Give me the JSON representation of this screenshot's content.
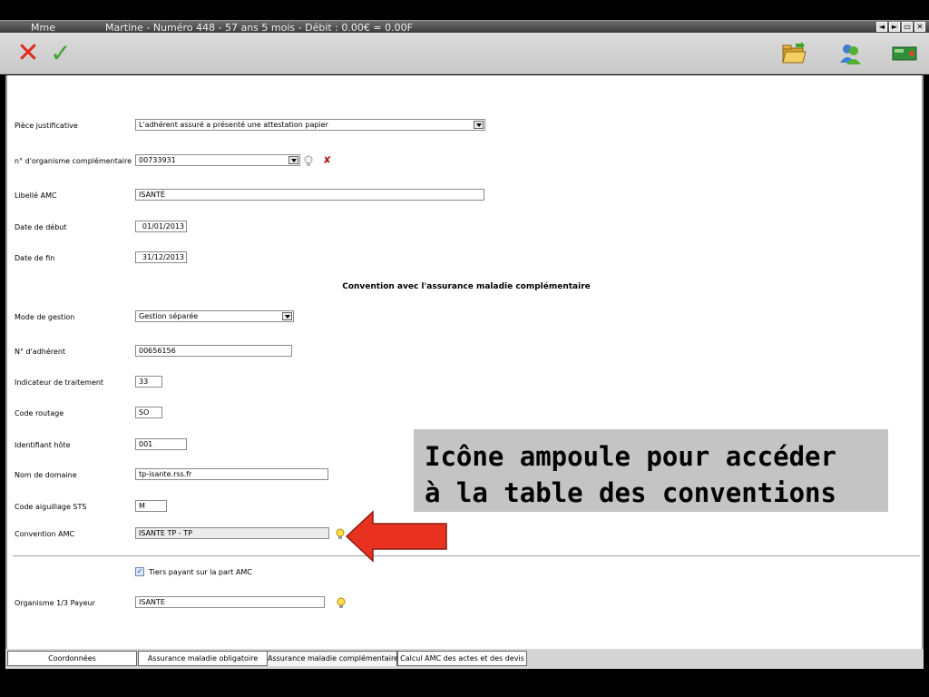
{
  "titlebar": {
    "left": "Mme",
    "main": "Martine  - Numéro 448  -  57 ans 5 mois  - Débit : 0.00€ = 0.00F",
    "buttons": [
      "◄",
      "►",
      "▭",
      "✕"
    ]
  },
  "toolbar": {
    "cancel_icon": "close-icon",
    "validate_icon": "check-icon"
  },
  "form": {
    "piece_label": "Pièce justificative",
    "piece_value": "L'adhérent assuré a présenté une attestation papier",
    "org_label": "n° d'organisme complémentaire",
    "org_value": "00733931",
    "libelle_label": "Libellé AMC",
    "libelle_value": "ISANTÉ",
    "debut_label": "Date de début",
    "debut_value": "01/01/2013",
    "fin_label": "Date de fin",
    "fin_value": "31/12/2013",
    "section_title": "Convention avec l'assurance maladie complémentaire",
    "mode_label": "Mode de gestion",
    "mode_value": "Gestion séparée",
    "adherent_label": "N° d'adhérent",
    "adherent_value": "00656156",
    "indicateur_label": "Indicateur de traitement",
    "indicateur_value": "33",
    "routage_label": "Code routage",
    "routage_value": "SO",
    "hote_label": "Identifiant hôte",
    "hote_value": "001",
    "domaine_label": "Nom de domaine",
    "domaine_value": "tp-isante.rss.fr",
    "aiguillage_label": "Code aiguillage STS",
    "aiguillage_value": "M",
    "convention_label": "Convention AMC",
    "convention_value": "ISANTE TP - TP",
    "tiers_label": "Tiers payant sur la part AMC",
    "tiers_checked": "✓",
    "organisme_label": "Organisme 1/3 Payeur",
    "organisme_value": "ISANTE"
  },
  "tabs": [
    {
      "label": "Coordonnées"
    },
    {
      "label": "Assurance maladie obligatoire"
    },
    {
      "label": "Assurance maladie complémentaire"
    },
    {
      "label": "Calcul AMC des actes et des devis"
    }
  ],
  "callout": {
    "line1": "Icône ampoule pour accéder",
    "line2": "à la table des conventions"
  },
  "colors": {
    "accent_red": "#e8321f",
    "accent_green": "#3fa52c",
    "callout_bg": "#c4c4c4"
  }
}
